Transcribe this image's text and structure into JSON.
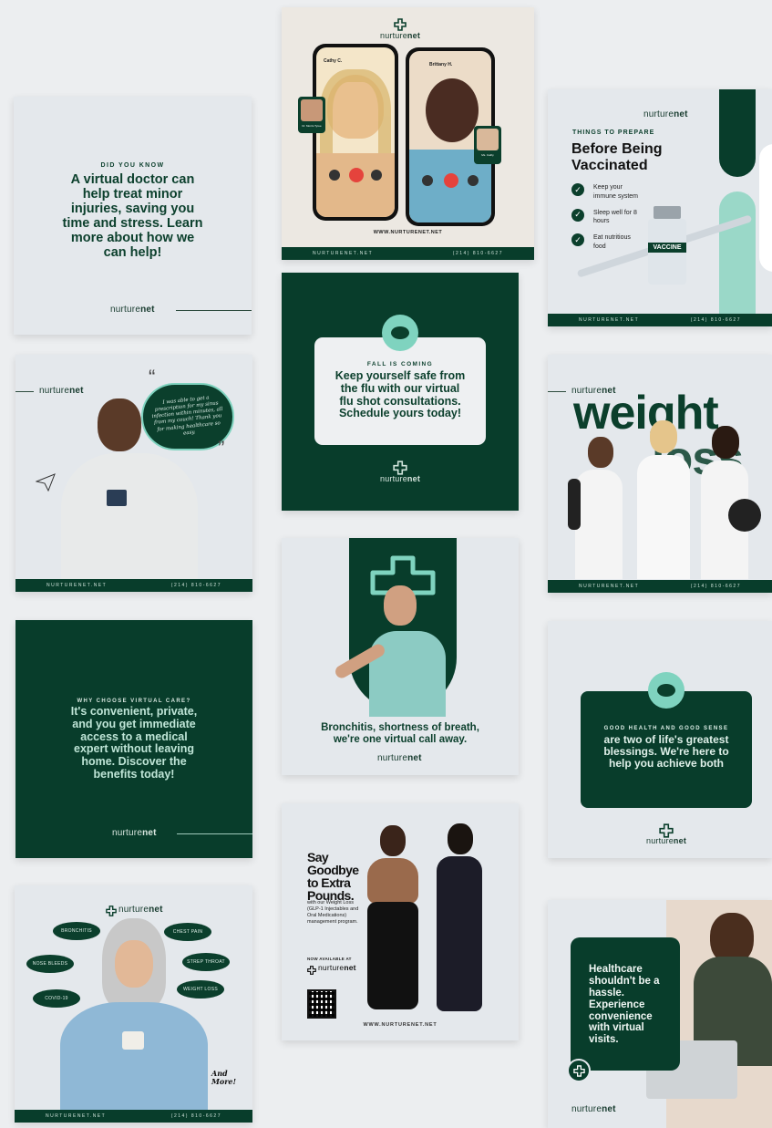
{
  "brand": {
    "name_a": "nurture",
    "name_b": "net",
    "site": "NURTURENET.NET",
    "phone": "(214) 810-6627",
    "site_lower": "WWW.NURTURENET.NET"
  },
  "colors": {
    "dark_green": "#083d2b",
    "mint": "#7fd3bf",
    "light_bg": "#e4e8ec"
  },
  "card1": {
    "eyebrow": "DID YOU KNOW",
    "headline": "A virtual doctor can help treat minor injuries, saving you time and stress. Learn more about how we can help!"
  },
  "card2": {
    "left_name": "Cathy C.",
    "right_name": "Brittany H.",
    "left_small": "Dr. Morris Tyree",
    "right_small": "Ms. Cathy"
  },
  "card3": {
    "eyebrow": "THINGS TO PREPARE",
    "title": "Before Being Vaccinated",
    "items": [
      "Keep your immune system",
      "Sleep well for 8 hours",
      "Eat nutritious food"
    ],
    "vial": "VACCINE"
  },
  "card4": {
    "quote": "I was able to get a prescription for my sinus infection within minutes, all from my couch! Thank you for making healthcare so easy."
  },
  "card5": {
    "eyebrow": "FALL IS COMING",
    "headline": "Keep yourself safe from the flu with our virtual flu shot consultations. Schedule yours today!"
  },
  "card6": {
    "word1": "weight",
    "word2": "loss"
  },
  "card7": {
    "eyebrow": "WHY CHOOSE VIRTUAL CARE?",
    "headline": "It's convenient, private, and you get immediate access to a medical expert without leaving home. Discover the benefits today!"
  },
  "card8": {
    "headline": "Bronchitis, shortness of breath, we're one virtual call away."
  },
  "card9": {
    "eyebrow": "GOOD HEALTH AND GOOD SENSE",
    "headline": "are two of life's greatest blessings. We're here to help you achieve both"
  },
  "card10": {
    "pills": [
      "BRONCHITIS",
      "CHEST PAIN",
      "NOSE BLEEDS",
      "STREP THROAT",
      "COVID-19",
      "WEIGHT LOSS"
    ],
    "more": "And More!"
  },
  "card11": {
    "headline": "Say Goodbye to Extra Pounds.",
    "body": "with our Weight Loss (GLP-1 Injectables and Oral Medications) management program.",
    "available": "NOW AVAILABLE AT"
  },
  "card12": {
    "headline": "Healthcare shouldn't be a hassle. Experience convenience with virtual visits."
  }
}
